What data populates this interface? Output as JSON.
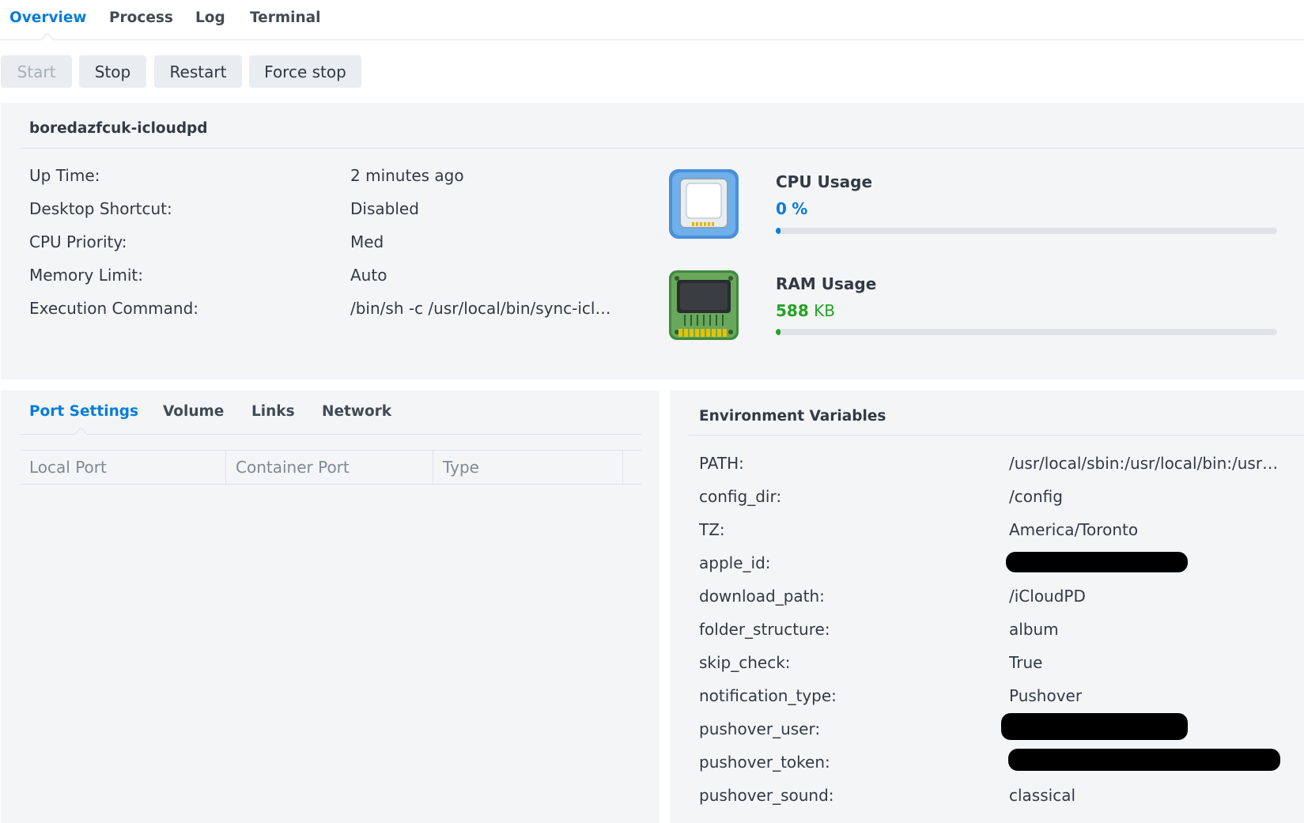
{
  "top_tabs": [
    {
      "label": "Overview",
      "active": true
    },
    {
      "label": "Process",
      "active": false
    },
    {
      "label": "Log",
      "active": false
    },
    {
      "label": "Terminal",
      "active": false
    }
  ],
  "actions": {
    "start": "Start",
    "stop": "Stop",
    "restart": "Restart",
    "force_stop": "Force stop"
  },
  "container": {
    "name": "boredazfcuk-icloudpd",
    "details": [
      {
        "label": "Up Time:",
        "value": "2 minutes ago"
      },
      {
        "label": "Desktop Shortcut:",
        "value": "Disabled"
      },
      {
        "label": "CPU Priority:",
        "value": "Med"
      },
      {
        "label": "Memory Limit:",
        "value": "Auto"
      },
      {
        "label": "Execution Command:",
        "value": "/bin/sh -c /usr/local/bin/sync-icloud.sh"
      }
    ]
  },
  "cpu": {
    "title": "CPU Usage",
    "value": "0",
    "unit": "%",
    "progress_fraction": 0.01,
    "color": "#0a7cd8",
    "icon": "cpu-chip-icon"
  },
  "ram": {
    "title": "RAM Usage",
    "value": "588",
    "unit": "KB",
    "progress_fraction": 0.01,
    "color": "#24a324",
    "icon": "ram-module-icon"
  },
  "sub_tabs": [
    {
      "label": "Port Settings",
      "active": true
    },
    {
      "label": "Volume",
      "active": false
    },
    {
      "label": "Links",
      "active": false
    },
    {
      "label": "Network",
      "active": false
    }
  ],
  "port_table": {
    "columns": [
      "Local Port",
      "Container Port",
      "Type"
    ]
  },
  "env": {
    "title": "Environment Variables",
    "vars": [
      {
        "name": "PATH:",
        "value": "/usr/local/sbin:/usr/local/bin:/usr/sbin:/usr/bin:/sbin:/bin",
        "redacted": false
      },
      {
        "name": "config_dir:",
        "value": "/config",
        "redacted": false
      },
      {
        "name": "TZ:",
        "value": "America/Toronto",
        "redacted": false
      },
      {
        "name": "apple_id:",
        "value": "",
        "redacted": true
      },
      {
        "name": "download_path:",
        "value": "/iCloudPD",
        "redacted": false
      },
      {
        "name": "folder_structure:",
        "value": "album",
        "redacted": false
      },
      {
        "name": "skip_check:",
        "value": "True",
        "redacted": false
      },
      {
        "name": "notification_type:",
        "value": "Pushover",
        "redacted": false
      },
      {
        "name": "pushover_user:",
        "value": "",
        "redacted": true
      },
      {
        "name": "pushover_token:",
        "value": "",
        "redacted": true
      },
      {
        "name": "pushover_sound:",
        "value": "classical",
        "redacted": false
      }
    ]
  },
  "colors": {
    "accent": "#0a7cd8",
    "ram_green": "#24a324",
    "panel_bg": "#f3f5f7"
  }
}
